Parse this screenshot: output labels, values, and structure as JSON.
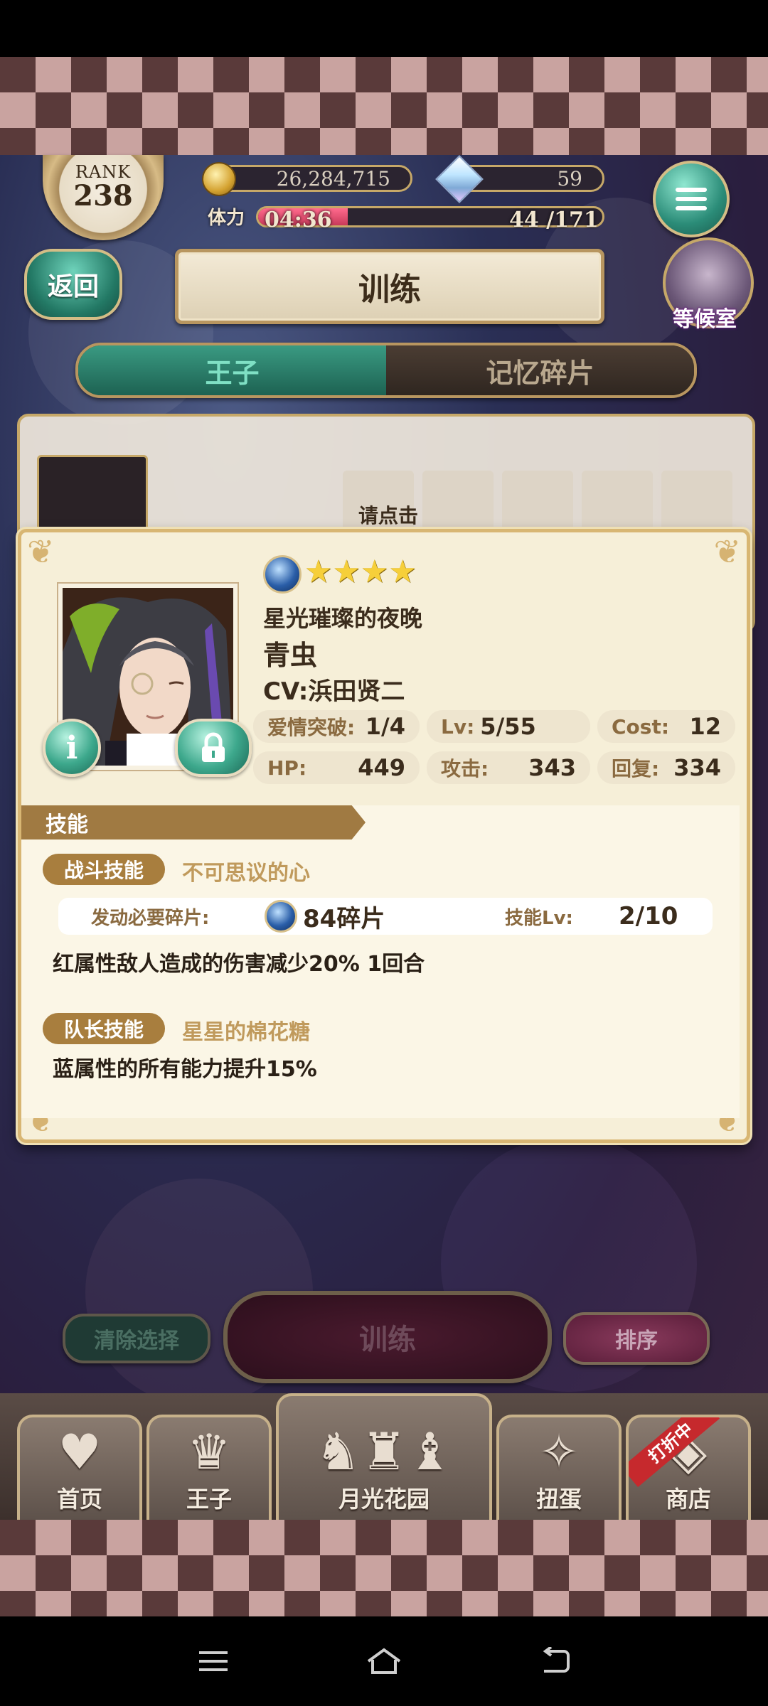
{
  "header": {
    "rank_label": "RANK",
    "rank_value": "238",
    "coins": "26,284,715",
    "gems": "59",
    "stamina_label": "体力",
    "stamina_timer": "04:36",
    "stamina_value": "44 /171",
    "stamina_fill_fraction": 0.26
  },
  "nav_top": {
    "back_label": "返回",
    "title": "训练",
    "waiting_room_label": "等候室",
    "menu_icon": "hamburger-menu-icon"
  },
  "tabs": [
    {
      "label": "王子",
      "active": true
    },
    {
      "label": "记忆碎片",
      "active": false
    }
  ],
  "background_hint": "请点击",
  "card": {
    "attribute_icon": "blue-attribute-orb-icon",
    "star_count": 4,
    "stars": "★★★★",
    "title": "星光璀璨的夜晚",
    "name": "青虫",
    "cv": "CV:浜田贤二",
    "stats": {
      "love_label": "爱情突破:",
      "love_value": "1/4",
      "lv_label": "Lv:",
      "lv_value": "5/55",
      "cost_label": "Cost:",
      "cost_value": "12",
      "hp_label": "HP:",
      "hp_value": "449",
      "atk_label": "攻击:",
      "atk_value": "343",
      "heal_label": "回复:",
      "heal_value": "334"
    },
    "skills_header": "技能",
    "battle_skill": {
      "tag": "战斗技能",
      "name": "不可思议的心",
      "req_label": "发动必要碎片:",
      "req_value": "84碎片",
      "lv_label": "技能Lv:",
      "lv_value": "2/10",
      "description": "红属性敌人造成的伤害减少20% 1回合"
    },
    "leader_skill": {
      "tag": "队长技能",
      "name": "星星的棉花糖",
      "description": "蓝属性的所有能力提升15%"
    }
  },
  "actions": {
    "clear_label": "清除选择",
    "train_label": "训练",
    "sort_label": "排序"
  },
  "bottom_nav": [
    {
      "label": "首页",
      "icon": "heart-icon"
    },
    {
      "label": "王子",
      "icon": "crown-icon"
    },
    {
      "label": "月光花园",
      "icon": "garden-silhouette-icon"
    },
    {
      "label": "扭蛋",
      "icon": "gacha-icon"
    },
    {
      "label": "商店",
      "icon": "shop-icon",
      "badge": "打折中"
    }
  ],
  "colors": {
    "teal_button": "#2b8c78",
    "gold_border": "#c6a868",
    "modal_bg": "#f6efd8",
    "skill_tag": "#a87e3e",
    "sale_ribbon": "#c6292d"
  }
}
